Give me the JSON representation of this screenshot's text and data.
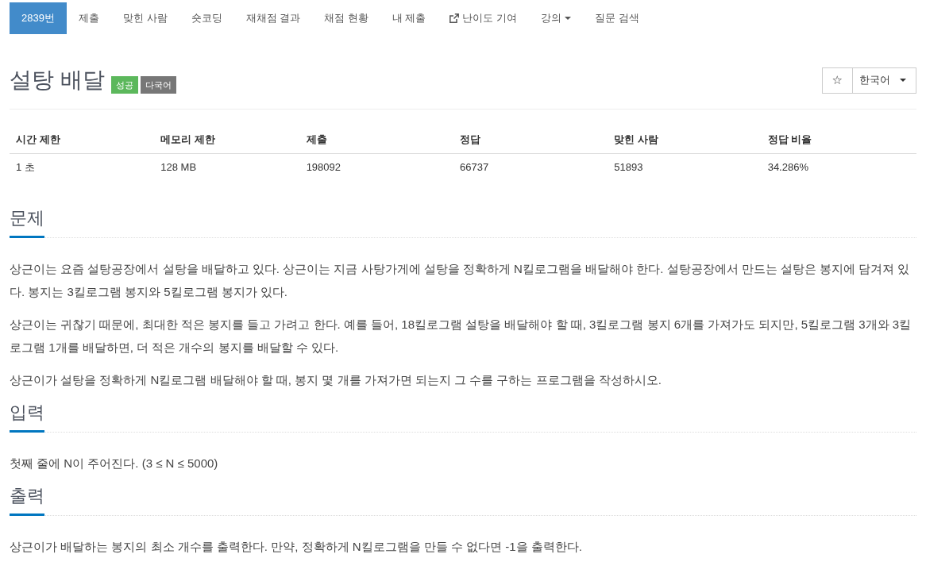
{
  "nav": {
    "tabs": [
      {
        "label": "2839번",
        "selected": true,
        "kind": "link"
      },
      {
        "label": "제출",
        "selected": false,
        "kind": "link"
      },
      {
        "label": "맞힌 사람",
        "selected": false,
        "kind": "link"
      },
      {
        "label": "숏코딩",
        "selected": false,
        "kind": "link"
      },
      {
        "label": "재채점 결과",
        "selected": false,
        "kind": "link"
      },
      {
        "label": "채점 현황",
        "selected": false,
        "kind": "link"
      },
      {
        "label": "내 제출",
        "selected": false,
        "kind": "link"
      },
      {
        "label": "난이도 기여",
        "selected": false,
        "kind": "external"
      },
      {
        "label": "강의",
        "selected": false,
        "kind": "dropdown"
      },
      {
        "label": "질문 검색",
        "selected": false,
        "kind": "link"
      }
    ]
  },
  "problem": {
    "title": "설탕 배달",
    "badges": [
      {
        "label": "성공",
        "color": "#5cb85c"
      },
      {
        "label": "다국어",
        "color": "#777777"
      }
    ],
    "star": "☆",
    "language": "한국어"
  },
  "stats": {
    "columns": [
      "시간 제한",
      "메모리 제한",
      "제출",
      "정답",
      "맞힌 사람",
      "정답 비율"
    ],
    "rows": [
      [
        "1 초",
        "128 MB",
        "198092",
        "66737",
        "51893",
        "34.286%"
      ]
    ]
  },
  "sections": [
    {
      "heading": "문제",
      "paragraphs": [
        "상근이는 요즘 설탕공장에서 설탕을 배달하고 있다. 상근이는 지금 사탕가게에 설탕을 정확하게 N킬로그램을 배달해야 한다. 설탕공장에서 만드는 설탕은 봉지에 담겨져 있다. 봉지는 3킬로그램 봉지와 5킬로그램 봉지가 있다.",
        "상근이는 귀찮기 때문에, 최대한 적은 봉지를 들고 가려고 한다. 예를 들어, 18킬로그램 설탕을 배달해야 할 때, 3킬로그램 봉지 6개를 가져가도 되지만, 5킬로그램 3개와 3킬로그램 1개를 배달하면, 더 적은 개수의 봉지를 배달할 수 있다.",
        "상근이가 설탕을 정확하게 N킬로그램 배달해야 할 때, 봉지 몇 개를 가져가면 되는지 그 수를 구하는 프로그램을 작성하시오."
      ]
    },
    {
      "heading": "입력",
      "paragraphs": [
        "첫째 줄에 N이 주어진다. (3 ≤ N ≤ 5000)"
      ]
    },
    {
      "heading": "출력",
      "paragraphs": [
        "상근이가 배달하는 봉지의 최소 개수를 출력한다. 만약, 정확하게 N킬로그램을 만들 수 없다면 -1을 출력한다."
      ]
    }
  ]
}
